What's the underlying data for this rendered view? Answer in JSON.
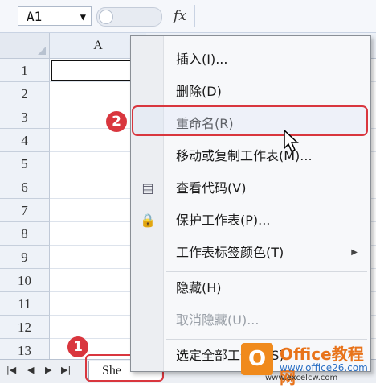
{
  "formula_bar": {
    "name_box": "A1",
    "fx_label": "fx"
  },
  "grid": {
    "column_header": "A",
    "row_numbers": [
      "1",
      "2",
      "3",
      "4",
      "5",
      "6",
      "7",
      "8",
      "9",
      "10",
      "11",
      "12",
      "13"
    ]
  },
  "sheet_tab": {
    "label": "She"
  },
  "context_menu": {
    "items": [
      {
        "label": "插入(I)...",
        "disabled": false
      },
      {
        "label": "删除(D)",
        "disabled": false
      },
      {
        "label": "重命名(R)",
        "disabled": false,
        "highlighted": true
      },
      {
        "label": "移动或复制工作表(M)...",
        "disabled": false
      },
      {
        "label": "查看代码(V)",
        "disabled": false,
        "icon": "view-code-icon"
      },
      {
        "label": "保护工作表(P)...",
        "disabled": false,
        "icon": "protect-sheet-icon"
      },
      {
        "label": "工作表标签颜色(T)",
        "disabled": false,
        "submenu": true
      },
      {
        "label": "隐藏(H)",
        "disabled": false
      },
      {
        "label": "取消隐藏(U)...",
        "disabled": true
      },
      {
        "label": "选定全部工作表(S)",
        "disabled": false
      }
    ]
  },
  "step_badges": [
    "1",
    "2"
  ],
  "watermark": {
    "brand": "Office教程网",
    "site": "www.office26.com",
    "url": "www.excelcw.com"
  },
  "colors": {
    "accent_red": "#d9363e",
    "logo_orange": "#f08a1c"
  }
}
